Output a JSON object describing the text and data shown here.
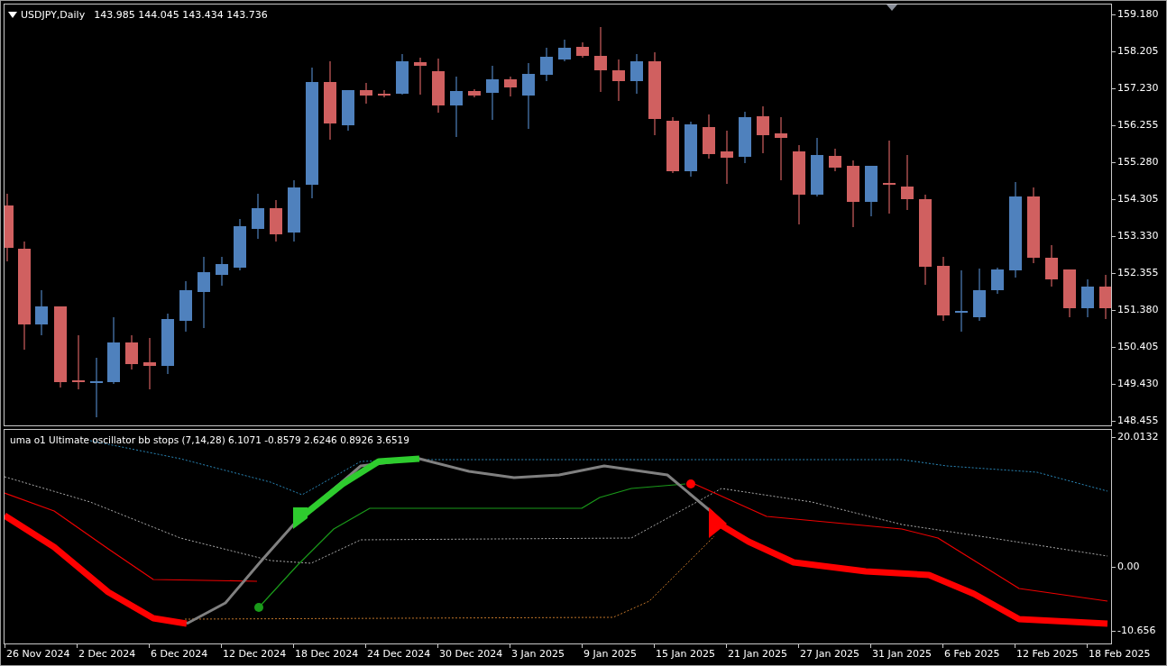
{
  "price_chart": {
    "symbol": "USDJPY,Daily",
    "ohlc": "143.985 144.045 143.434 143.736",
    "price_axis": [
      "159.180",
      "158.205",
      "157.230",
      "156.255",
      "155.280",
      "154.305",
      "153.330",
      "152.355",
      "151.380",
      "150.405",
      "149.430",
      "148.455"
    ]
  },
  "indicator": {
    "title": "uma o1 Ultimate oscillator bb stops (7,14,28) 6.1071 -0.8579 2.6246 0.8926 3.6519",
    "axis": [
      "20.0132",
      "0.00",
      "-10.656"
    ]
  },
  "date_axis": [
    "26 Nov 2024",
    "2 Dec 2024",
    "6 Dec 2024",
    "12 Dec 2024",
    "18 Dec 2024",
    "24 Dec 2024",
    "30 Dec 2024",
    "3 Jan 2025",
    "9 Jan 2025",
    "15 Jan 2025",
    "21 Jan 2025",
    "27 Jan 2025",
    "31 Jan 2025",
    "6 Feb 2025",
    "12 Feb 2025",
    "18 Feb 2025"
  ]
}
